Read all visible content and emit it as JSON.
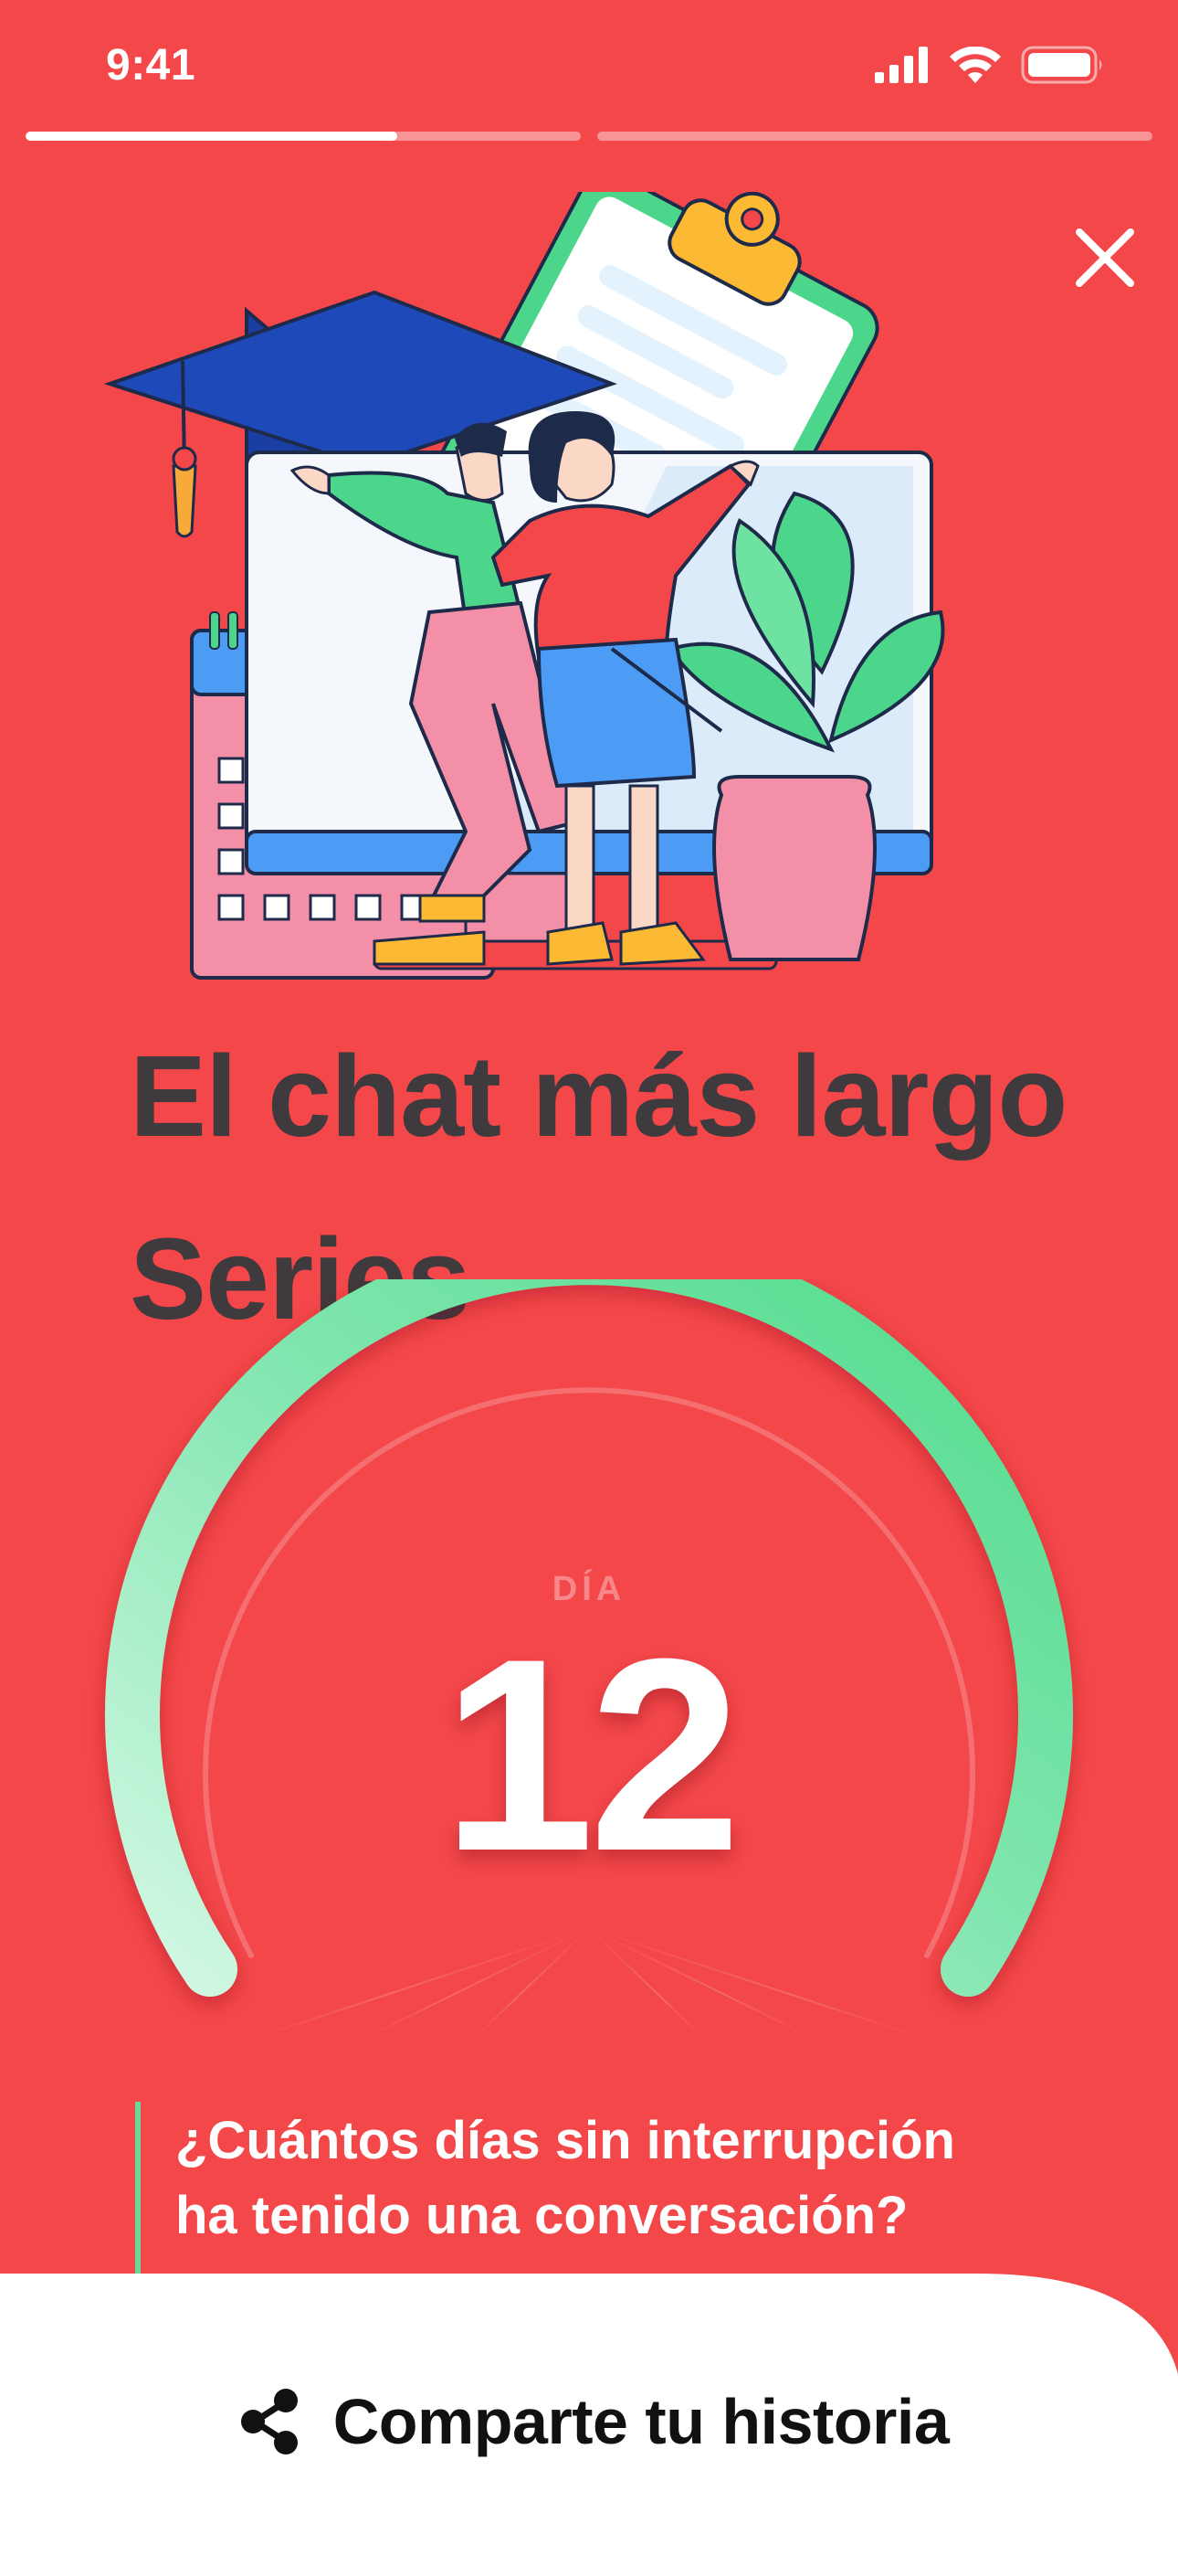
{
  "status_bar": {
    "time": "9:41",
    "icons": [
      "cellular-signal-icon",
      "wifi-icon",
      "battery-icon"
    ]
  },
  "story_progress": {
    "segments": [
      {
        "filled_fraction": 0.67
      },
      {
        "filled_fraction": 0.0
      }
    ]
  },
  "close": {
    "icon": "close-icon"
  },
  "illustration": {
    "description_icons": [
      "graduation-cap-icon",
      "clipboard-icon",
      "calendar-icon",
      "monitor-icon",
      "plant-icon",
      "man-figure-icon",
      "woman-figure-icon"
    ]
  },
  "title": {
    "line1": "El chat más largo",
    "line2": "Series"
  },
  "gauge": {
    "label": "DÍA",
    "value": "12"
  },
  "question": {
    "line1": "¿Cuántos días sin interrupción",
    "line2": "ha tenido una conversación?"
  },
  "share": {
    "label": "Comparte tu historia",
    "icon": "share-icon"
  },
  "colors": {
    "background": "#F3474A",
    "title_text": "#3E3A3D",
    "gauge_start": "#D3F8E4",
    "gauge_end": "#4FDB8A",
    "accent_bar": "#67D99A",
    "sheet": "#FFFFFF"
  }
}
